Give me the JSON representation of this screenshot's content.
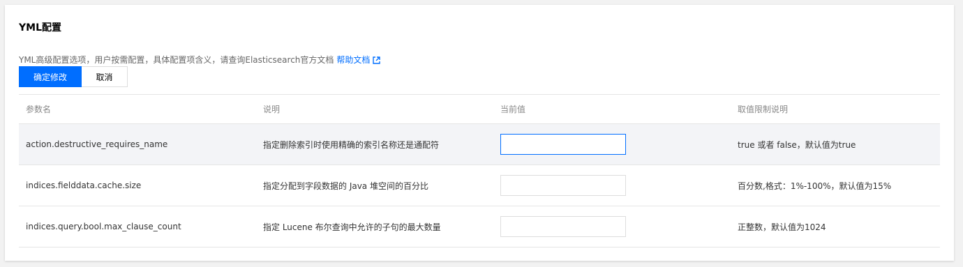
{
  "section": {
    "title": "YML配置",
    "description": "YML高级配置选项，用户按需配置，具体配置项含义，请查询Elasticsearch官方文档",
    "help_link": "帮助文档",
    "help_link_icon": "external-link-icon"
  },
  "buttons": {
    "confirm": "确定修改",
    "cancel": "取消"
  },
  "colors": {
    "primary": "#006eff",
    "row_highlight": "#f3f4f7"
  },
  "table": {
    "headers": [
      "参数名",
      "说明",
      "当前值",
      "取值限制说明"
    ],
    "rows": [
      {
        "name": "action.destructive_requires_name",
        "description": "指定删除索引时使用精确的索引名称还是通配符",
        "value": "",
        "constraint": "true 或者 false，默认值为true"
      },
      {
        "name": "indices.fielddata.cache.size",
        "description": "指定分配到字段数据的 Java 堆空间的百分比",
        "value": "",
        "constraint": "百分数,格式：1%-100%，默认值为15%"
      },
      {
        "name": "indices.query.bool.max_clause_count",
        "description": "指定 Lucene 布尔查询中允许的子句的最大数量",
        "value": "",
        "constraint": "正整数，默认值为1024"
      }
    ]
  }
}
